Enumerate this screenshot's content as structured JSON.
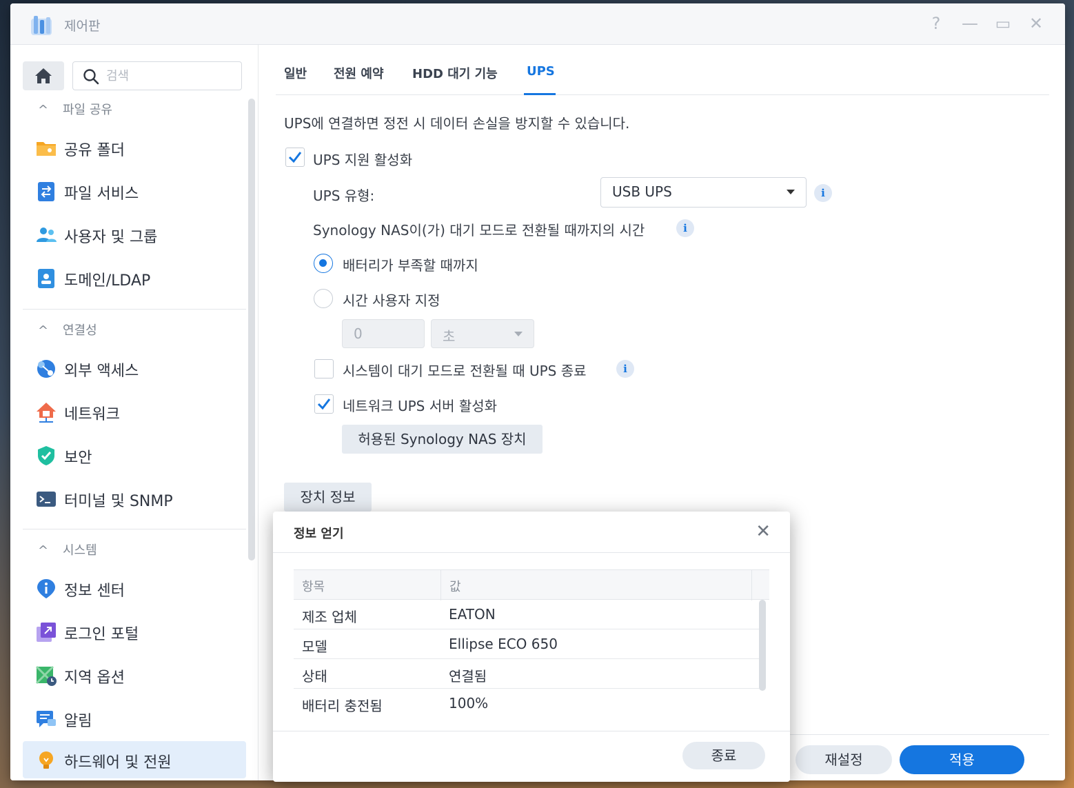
{
  "window": {
    "title": "제어판",
    "buttons": {
      "help": "?",
      "minimize": "—",
      "maximize": "▭",
      "close": "✕"
    }
  },
  "sidebar": {
    "search_placeholder": "검색",
    "sections": [
      {
        "title": "파일 공유",
        "items": [
          {
            "label": "공유 폴더",
            "icon": "shared-folder-icon"
          },
          {
            "label": "파일 서비스",
            "icon": "file-services-icon"
          },
          {
            "label": "사용자 및 그룹",
            "icon": "users-groups-icon"
          },
          {
            "label": "도메인/LDAP",
            "icon": "domain-ldap-icon"
          }
        ]
      },
      {
        "title": "연결성",
        "items": [
          {
            "label": "외부 액세스",
            "icon": "external-access-icon"
          },
          {
            "label": "네트워크",
            "icon": "network-icon"
          },
          {
            "label": "보안",
            "icon": "security-shield-icon"
          },
          {
            "label": "터미널 및 SNMP",
            "icon": "terminal-icon"
          }
        ]
      },
      {
        "title": "시스템",
        "items": [
          {
            "label": "정보 센터",
            "icon": "info-center-icon"
          },
          {
            "label": "로그인 포털",
            "icon": "login-portal-icon"
          },
          {
            "label": "지역 옵션",
            "icon": "regional-options-icon"
          },
          {
            "label": "알림",
            "icon": "notification-icon"
          },
          {
            "label": "하드웨어 및 전원",
            "icon": "hardware-power-icon",
            "active": true
          }
        ]
      }
    ]
  },
  "tabs": [
    "일반",
    "전원 예약",
    "HDD 대기 기능",
    "UPS"
  ],
  "active_tab": "UPS",
  "ups": {
    "description": "UPS에 연결하면 정전 시 데이터 손실을 방지할 수 있습니다.",
    "enable_label": "UPS 지원 활성화",
    "enable_checked": true,
    "type_label": "UPS 유형:",
    "type_value": "USB UPS",
    "standby_label": "Synology NAS이(가) 대기 모드로 전환될 때까지의 시간",
    "radio_battery_low": "배터리가 부족할 때까지",
    "radio_custom": "시간 사용자 지정",
    "custom_value": "0",
    "custom_unit": "초",
    "shutdown_label": "시스템이 대기 모드로 전환될 때 UPS 종료",
    "shutdown_checked": false,
    "network_server_label": "네트워크 UPS 서버 활성화",
    "network_server_checked": true,
    "allowed_devices_button": "허용된 Synology NAS 장치",
    "device_info_button": "장치 정보"
  },
  "footer": {
    "reset_button": "재설정",
    "apply_button": "적용"
  },
  "dialog": {
    "title": "정보 얻기",
    "columns": [
      "항목",
      "값"
    ],
    "rows": [
      {
        "item": "제조 업체",
        "value": "EATON"
      },
      {
        "item": "모델",
        "value": "Ellipse ECO 650"
      },
      {
        "item": "상태",
        "value": "연결됨"
      },
      {
        "item": "배터리 충전됨",
        "value": "100%"
      }
    ],
    "close_button": "종료"
  },
  "colors": {
    "accent": "#1576e0",
    "active_bg": "#e3eefb"
  }
}
